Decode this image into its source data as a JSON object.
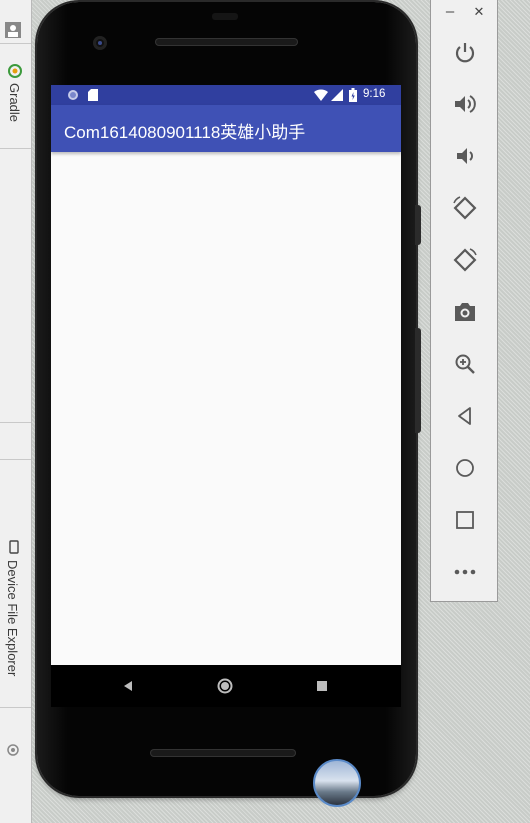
{
  "ide_sidebar": {
    "gradle_label": "Gradle",
    "device_file_explorer_label": "Device File Explorer"
  },
  "phone": {
    "status_bar": {
      "time": "9:16"
    },
    "app_bar": {
      "title": "Com1614080901118英雄小助手"
    },
    "nav_bar": {
      "back": "back-icon",
      "home": "home-icon",
      "recents": "recents-icon"
    }
  },
  "emulator_toolbar": {
    "minimize_label": "–",
    "close_label": "✕",
    "tools": [
      "power-icon",
      "volume-up-icon",
      "volume-down-icon",
      "rotate-left-icon",
      "rotate-right-icon",
      "camera-icon",
      "zoom-in-icon",
      "back-icon",
      "home-icon",
      "overview-icon",
      "more-icon"
    ]
  },
  "colors": {
    "status_bar": "#303f9f",
    "app_bar": "#3f51b5",
    "screen_bg": "#fafafa",
    "toolbar_icon": "#5a5a5a"
  }
}
